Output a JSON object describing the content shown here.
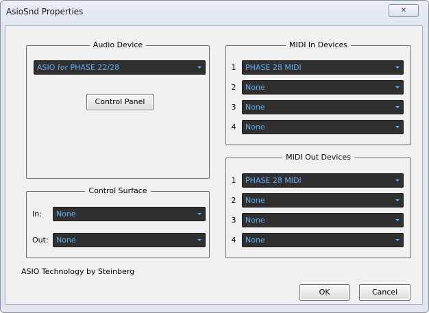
{
  "window": {
    "title": "AsioSnd Properties",
    "close_glyph": "✕"
  },
  "audio_device": {
    "title": "Audio Device",
    "selected": "ASIO for PHASE 22/28",
    "control_panel_label": "Control Panel"
  },
  "control_surface": {
    "title": "Control Surface",
    "in_label": "In:",
    "in_value": "None",
    "out_label": "Out:",
    "out_value": "None"
  },
  "midi_in": {
    "title": "MIDI In Devices",
    "rows": [
      {
        "num": "1",
        "value": "PHASE 28 MIDI"
      },
      {
        "num": "2",
        "value": "None"
      },
      {
        "num": "3",
        "value": "None"
      },
      {
        "num": "4",
        "value": "None"
      }
    ]
  },
  "midi_out": {
    "title": "MIDI Out Devices",
    "rows": [
      {
        "num": "1",
        "value": "PHASE 28 MIDI"
      },
      {
        "num": "2",
        "value": "None"
      },
      {
        "num": "3",
        "value": "None"
      },
      {
        "num": "4",
        "value": "None"
      }
    ]
  },
  "footer": {
    "credit": "ASIO Technology by Steinberg",
    "ok_label": "OK",
    "cancel_label": "Cancel"
  },
  "colors": {
    "combo_bg": "#303030",
    "combo_text": "#5fb0ff"
  }
}
